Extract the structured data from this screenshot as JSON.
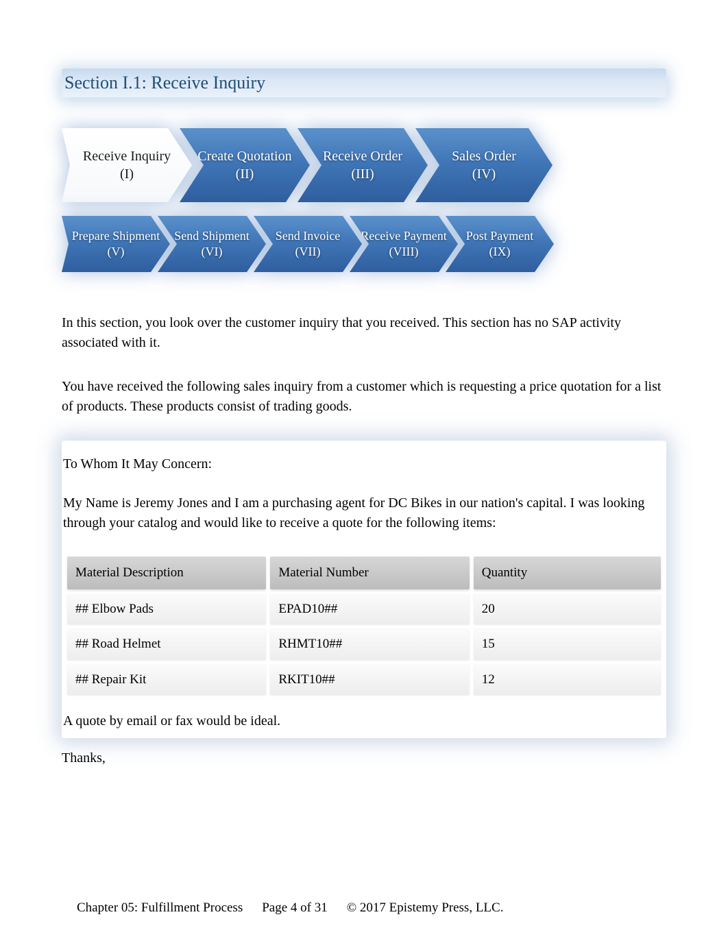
{
  "heading": "Section I.1: Receive Inquiry",
  "process": {
    "row1": [
      {
        "label": "Receive Inquiry",
        "num": "(I)",
        "active": true
      },
      {
        "label": "Create Quotation",
        "num": "(II)",
        "active": false
      },
      {
        "label": "Receive Order",
        "num": "(III)",
        "active": false
      },
      {
        "label": "Sales Order",
        "num": "(IV)",
        "active": false
      }
    ],
    "row2": [
      {
        "label": "Prepare Shipment",
        "num": "(V)"
      },
      {
        "label": "Send Shipment",
        "num": "(VI)"
      },
      {
        "label": "Send Invoice",
        "num": "(VII)"
      },
      {
        "label": "Receive Payment",
        "num": "(VIII)"
      },
      {
        "label": "Post Payment",
        "num": "(IX)"
      }
    ]
  },
  "paragraphs": {
    "p1": "In this section, you look over the customer inquiry that you received. This section has no SAP activity associated with it.",
    "p2": "You have received the following sales inquiry from a customer which is requesting a price quotation for a list of products. These products consist of trading goods."
  },
  "letter": {
    "salutation": "To Whom It May Concern:",
    "intro": "My Name is Jeremy Jones and I am a purchasing agent for DC Bikes in our nation's capital. I was looking through your catalog and would like to receive a quote for the following items:",
    "table": {
      "headers": {
        "desc": "Material Description",
        "num": "Material Number",
        "qty": "Quantity"
      },
      "rows": [
        {
          "desc": "## Elbow Pads",
          "num": "EPAD10##",
          "qty": "20"
        },
        {
          "desc": "## Road Helmet",
          "num": "RHMT10##",
          "qty": "15"
        },
        {
          "desc": "## Repair Kit",
          "num": "RKIT10##",
          "qty": "12"
        }
      ]
    },
    "closing1": "A quote by email or fax would be ideal.",
    "closing2": "Thanks,"
  },
  "footer": {
    "chapter": "Chapter 05: Fulfillment Process",
    "page": "Page 4 of 31",
    "copyright": "© 2017 Epistemy Press, LLC."
  }
}
